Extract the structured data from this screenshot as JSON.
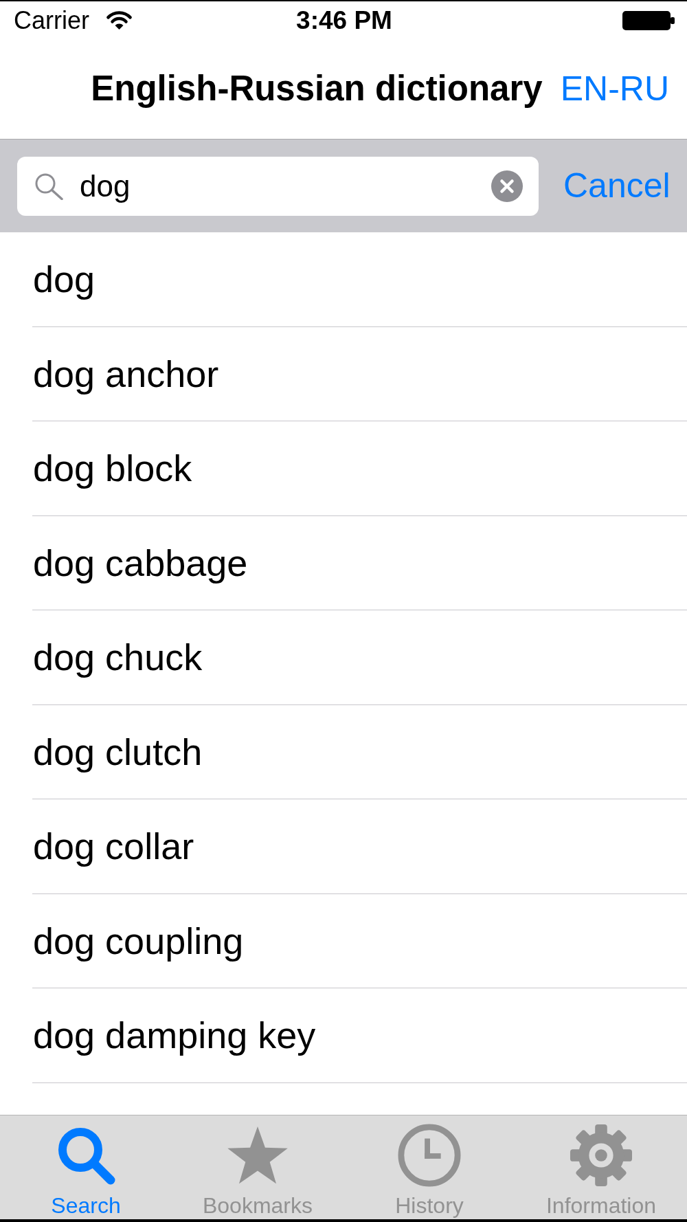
{
  "status_bar": {
    "carrier": "Carrier",
    "time": "3:46 PM"
  },
  "nav_bar": {
    "title": "English-Russian dictionary",
    "direction_button": "EN-RU"
  },
  "search": {
    "value": "dog",
    "cancel_button": "Cancel"
  },
  "results": [
    "dog",
    "dog anchor",
    "dog block",
    "dog cabbage",
    "dog chuck",
    "dog clutch",
    "dog collar",
    "dog coupling",
    "dog damping key"
  ],
  "tab_bar": [
    {
      "kind": "search",
      "label": "Search",
      "selected": true
    },
    {
      "kind": "star",
      "label": "Bookmarks",
      "selected": false
    },
    {
      "kind": "clock",
      "label": "History",
      "selected": false
    },
    {
      "kind": "gear",
      "label": "Information",
      "selected": false
    }
  ]
}
